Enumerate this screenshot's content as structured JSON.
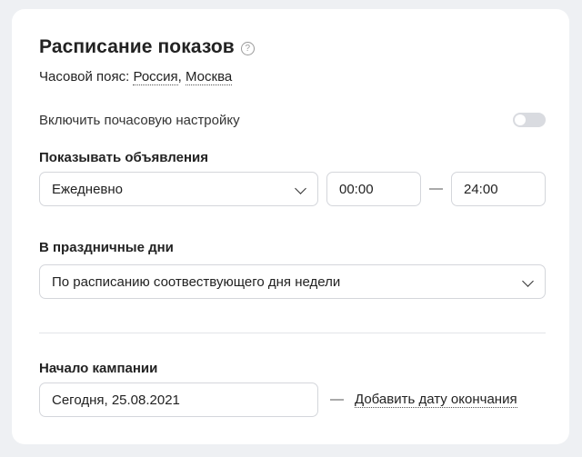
{
  "schedule": {
    "title": "Расписание показов",
    "help_icon": "question-circle-icon",
    "timezone_label": "Часовой пояс:",
    "timezone_country": "Россия",
    "timezone_separator": ",",
    "timezone_city": "Москва",
    "hourly_label": "Включить почасовую настройку",
    "hourly_enabled": false
  },
  "show_ads": {
    "label": "Показывать объявления",
    "frequency_value": "Ежедневно",
    "time_from": "00:00",
    "range_dash": "—",
    "time_to": "24:00"
  },
  "holidays": {
    "label": "В праздничные дни",
    "value": "По расписанию соотвествующего дня недели"
  },
  "campaign_start": {
    "label": "Начало кампании",
    "date_value": "Сегодня, 25.08.2021",
    "dash": "—",
    "add_end_date_link": "Добавить дату окончания"
  },
  "colors": {
    "background": "#eef0f3",
    "card": "#ffffff",
    "border": "#d4d6db",
    "toggle_off": "#d9dbe0"
  }
}
